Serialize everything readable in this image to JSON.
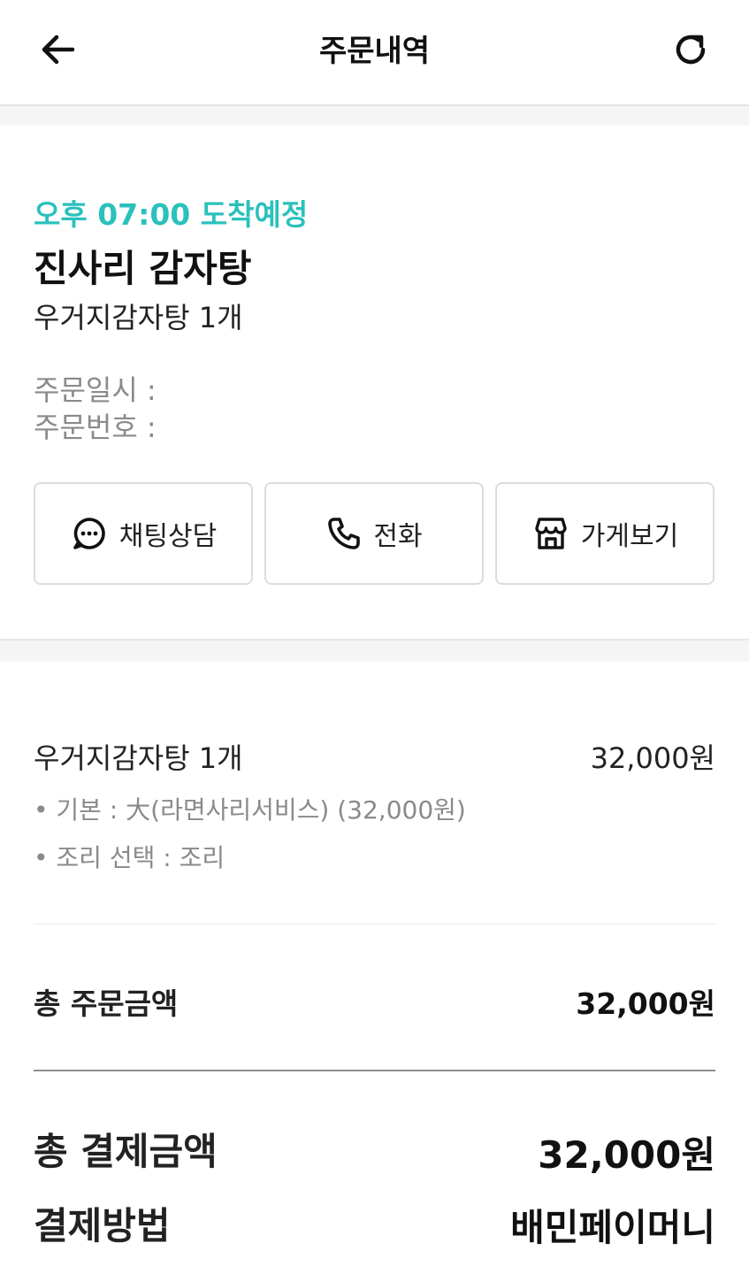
{
  "header": {
    "title": "주문내역",
    "back_icon": "arrow-left-icon",
    "refresh_icon": "refresh-icon"
  },
  "order": {
    "eta": "오후 07:00 도착예정",
    "store_name": "진사리 감자탕",
    "summary": "우거지감자탕 1개",
    "order_date_label": "주문일시 :",
    "order_number_label": "주문번호 :",
    "accent_color": "#2ac1bc"
  },
  "actions": [
    {
      "label": "채팅상담",
      "icon": "chat-bubble-icon"
    },
    {
      "label": "전화",
      "icon": "phone-icon"
    },
    {
      "label": "가게보기",
      "icon": "store-icon"
    }
  ],
  "detail": {
    "item_name": "우거지감자탕 1개",
    "item_price": "32,000원",
    "options": [
      "• 기본 : 大(라면사리서비스) (32,000원)",
      "• 조리 선택 : 조리"
    ],
    "subtotal_label": "총 주문금액",
    "subtotal_value": "32,000원",
    "total_label": "총 결제금액",
    "total_value": "32,000원",
    "payment_method_label": "결제방법",
    "payment_method_value": "배민페이머니"
  }
}
